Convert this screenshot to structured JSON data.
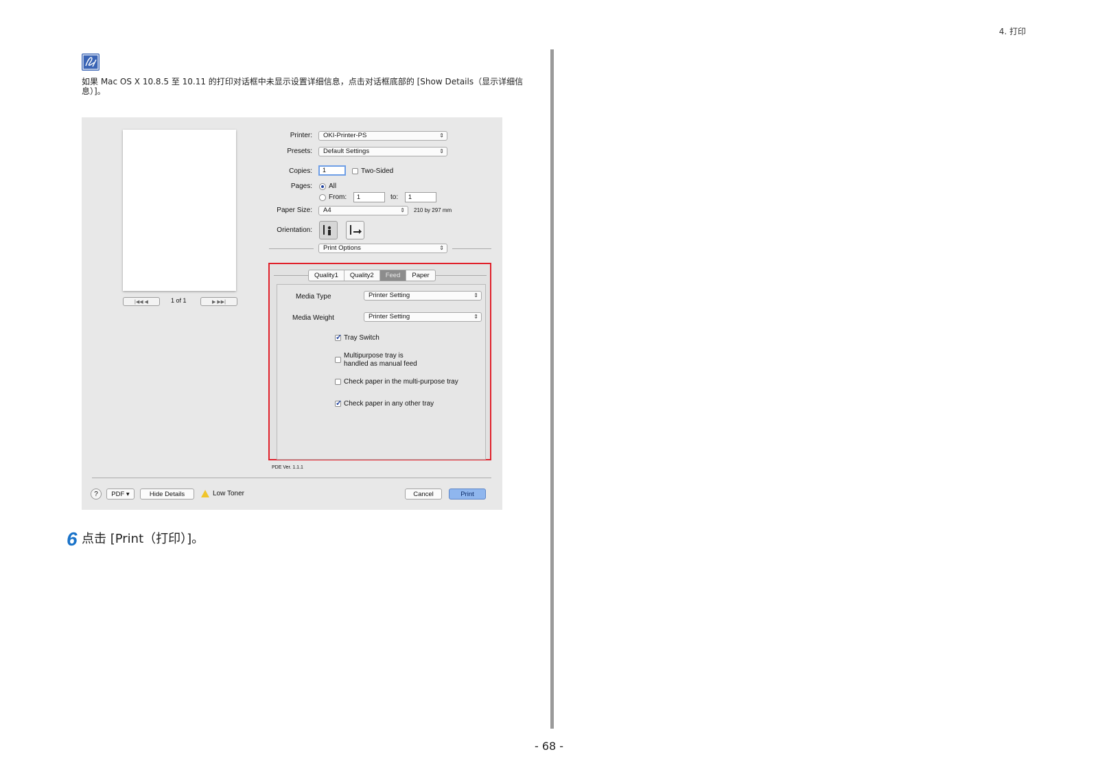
{
  "header": {
    "chapter": "4. 打印"
  },
  "footer": {
    "page_number": "- 68 -"
  },
  "note": {
    "icon": "memo-pen-icon",
    "text": "如果 Mac OS X 10.8.5 至 10.11 的打印对话框中未显示设置详细信息，点击对话框底部的 [Show Details（显示详细信息）]。"
  },
  "step": {
    "number": "6",
    "text": "点击 [Print（打印）]。"
  },
  "dialog": {
    "preview": {
      "page_indicator": "1 of 1",
      "first_prev": "|◀◀  ◀",
      "next_last": "▶  ▶▶|"
    },
    "printer": {
      "label": "Printer:",
      "value": "OKI-Printer-PS"
    },
    "presets": {
      "label": "Presets:",
      "value": "Default Settings"
    },
    "copies": {
      "label": "Copies:",
      "value": "1",
      "two_sided_label": "Two-Sided"
    },
    "pages": {
      "label": "Pages:",
      "all_label": "All",
      "from_label": "From:",
      "from_value": "1",
      "to_label": "to:",
      "to_value": "1"
    },
    "paper_size": {
      "label": "Paper Size:",
      "value": "A4",
      "dimensions": "210 by 297 mm"
    },
    "orientation": {
      "label": "Orientation:"
    },
    "section_popup": "Print Options",
    "tabs": [
      "Quality1",
      "Quality2",
      "Feed",
      "Paper"
    ],
    "selected_tab": "Feed",
    "feed": {
      "media_type_label": "Media Type",
      "media_type_value": "Printer Setting",
      "media_weight_label": "Media Weight",
      "media_weight_value": "Printer Setting",
      "tray_switch": "Tray Switch",
      "multipurpose_line1": "Multipurpose tray is",
      "multipurpose_line2": "handled as manual feed",
      "check_mp": "Check paper in the multi-purpose tray",
      "check_other": "Check paper in any other tray"
    },
    "pde_version": "PDE Ver. 1.1.1",
    "bottom": {
      "help": "?",
      "pdf": "PDF ▾",
      "hide_details": "Hide Details",
      "low_toner": "Low Toner",
      "cancel": "Cancel",
      "print": "Print"
    }
  }
}
